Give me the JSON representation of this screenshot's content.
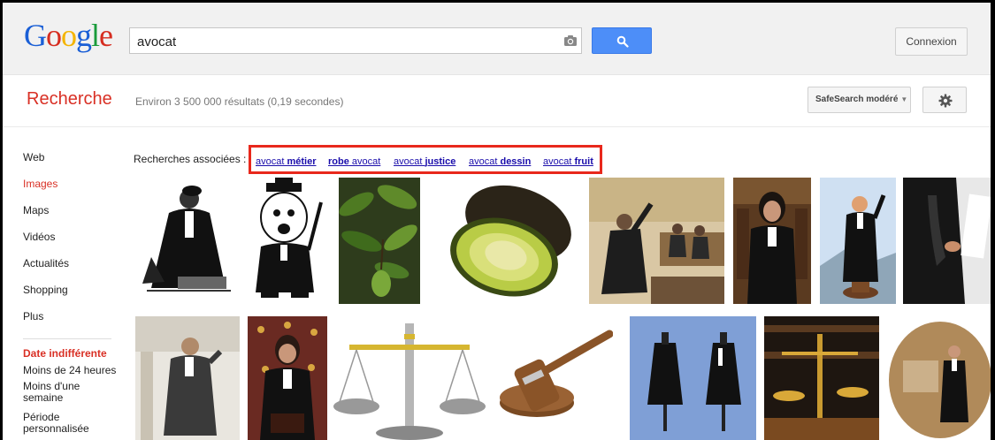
{
  "header": {
    "logo_text": "Google",
    "search_value": "avocat",
    "connexion_label": "Connexion"
  },
  "section": {
    "title": "Recherche",
    "result_stats": "Environ 3 500 000 résultats (0,19 secondes)",
    "safesearch_label": "SafeSearch modéré"
  },
  "sidebar": {
    "items": [
      {
        "label": "Web"
      },
      {
        "label": "Images",
        "active": true
      },
      {
        "label": "Maps"
      },
      {
        "label": "Vidéos"
      },
      {
        "label": "Actualités"
      },
      {
        "label": "Shopping"
      },
      {
        "label": "Plus"
      }
    ],
    "date_title": "Date indifférente",
    "date_filters": [
      "Moins de 24 heures",
      "Moins d'une semaine",
      "Période personnalisée"
    ]
  },
  "related": {
    "label": "Recherches associées :",
    "links": [
      {
        "prefix": "avocat ",
        "bold": "métier"
      },
      {
        "prefix": "",
        "bold": "robe",
        "suffix": " avocat"
      },
      {
        "prefix": "avocat ",
        "bold": "justice"
      },
      {
        "prefix": "avocat ",
        "bold": "dessin"
      },
      {
        "prefix": "avocat ",
        "bold": "fruit"
      }
    ]
  },
  "colors": {
    "accent_red": "#d93025",
    "search_blue": "#4d8ef8",
    "link_blue": "#1a0dab",
    "highlight_box": "#e8281c"
  }
}
